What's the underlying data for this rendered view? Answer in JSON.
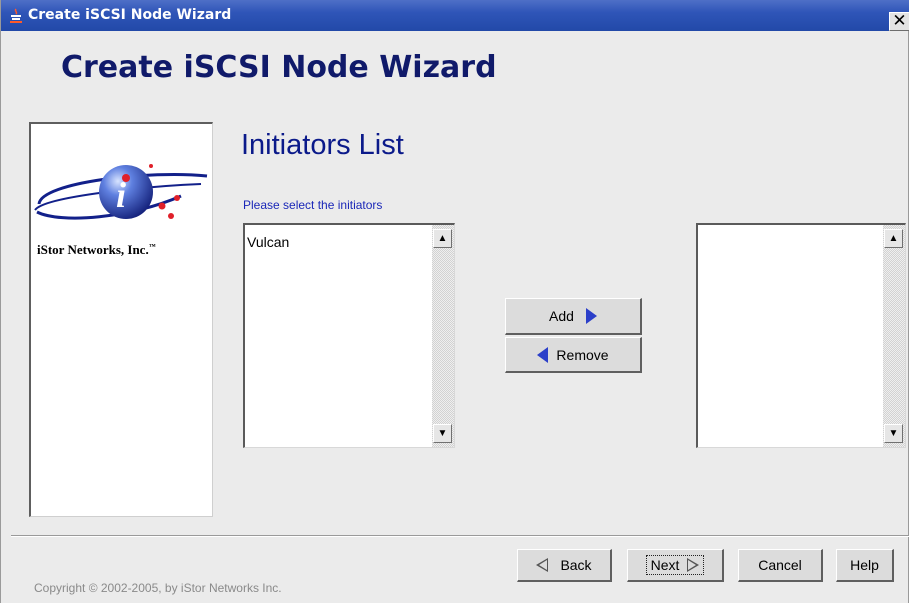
{
  "window": {
    "title": "Create iSCSI Node Wizard",
    "close_label": "✕",
    "app_icon": "java-cup-icon",
    "title_bar_color": "#2f55b8"
  },
  "header": {
    "title": "Create iSCSI Node Wizard",
    "title_color": "#101a6a"
  },
  "sidebar": {
    "logo": "istor-networks-logo-icon",
    "company_name": "iStor Networks, Inc.",
    "company_mark": "™"
  },
  "main": {
    "section_title": "Initiators List",
    "instruction": "Please select the initiators",
    "available_list": {
      "items": [
        "Vulcan"
      ]
    },
    "selected_list": {
      "items": []
    },
    "add_label": "Add",
    "remove_label": "Remove",
    "accent_color": "#2b3fc9"
  },
  "footer": {
    "back_label": "Back",
    "next_label": "Next",
    "cancel_label": "Cancel",
    "help_label": "Help",
    "copyright": "Copyright © 2002-2005, by iStor Networks Inc."
  }
}
